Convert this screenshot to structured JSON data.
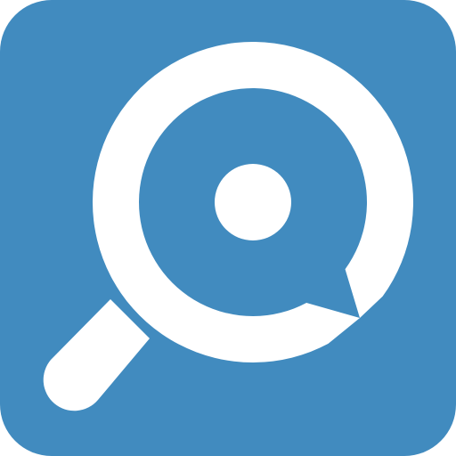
{
  "icon": {
    "name": "search-chat-icon",
    "colors": {
      "background": "#418BBF",
      "foreground": "#FFFFFF"
    }
  }
}
